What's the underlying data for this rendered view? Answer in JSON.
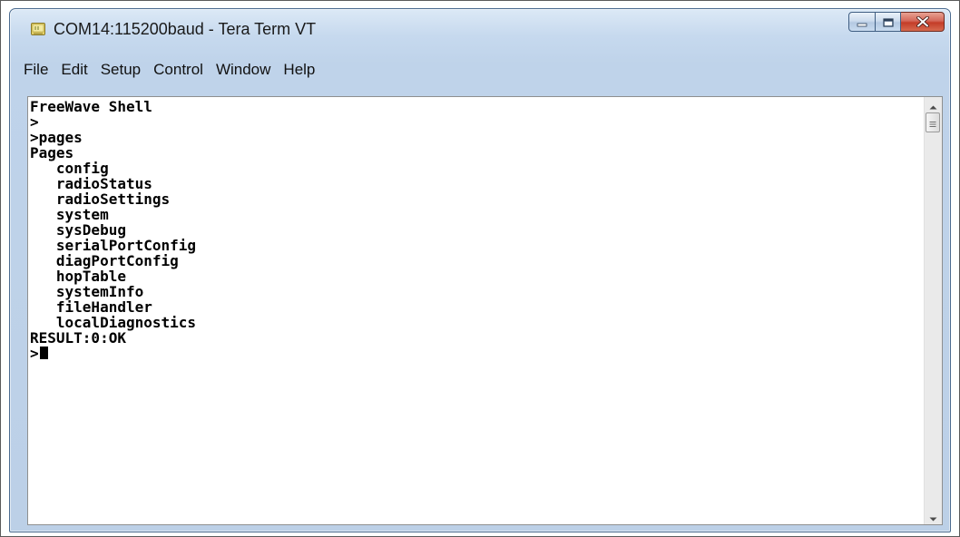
{
  "window": {
    "title": "COM14:115200baud - Tera Term VT",
    "app_icon": "tera-term-app-icon",
    "controls": {
      "minimize_icon": "minimize-icon",
      "maximize_icon": "maximize-icon",
      "close_icon": "close-icon"
    }
  },
  "menu": {
    "items": [
      {
        "label": "File"
      },
      {
        "label": "Edit"
      },
      {
        "label": "Setup"
      },
      {
        "label": "Control"
      },
      {
        "label": "Window"
      },
      {
        "label": "Help"
      }
    ]
  },
  "terminal": {
    "lines": [
      "FreeWave Shell",
      ">",
      ">pages",
      "Pages",
      "   config",
      "   radioStatus",
      "   radioSettings",
      "   system",
      "   sysDebug",
      "   serialPortConfig",
      "   diagPortConfig",
      "   hopTable",
      "   systemInfo",
      "   fileHandler",
      "   localDiagnostics",
      "RESULT:0:OK"
    ],
    "prompt": ">"
  },
  "scrollbar": {
    "up_icon": "scroll-up-arrow-icon",
    "down_icon": "scroll-down-arrow-icon",
    "thumb_icon": "scroll-thumb-grip-icon"
  },
  "colors": {
    "terminal_bg": "#ffffff",
    "terminal_fg": "#000000",
    "frame": "#bfd3ea",
    "close_button": "#c43c28"
  }
}
